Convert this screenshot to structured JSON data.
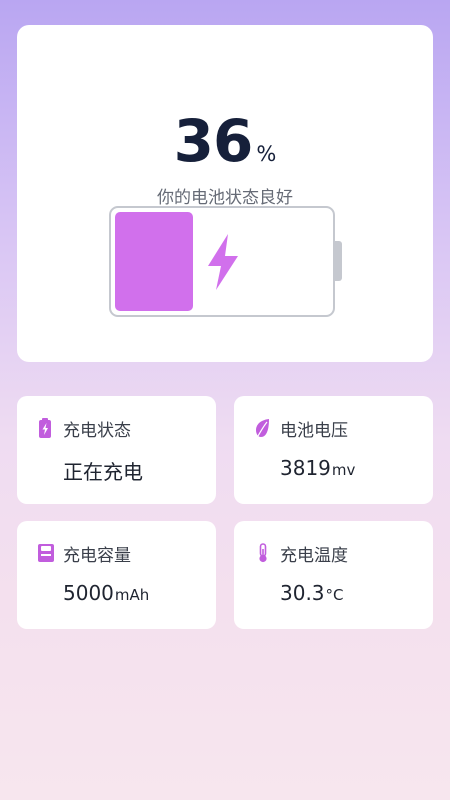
{
  "battery": {
    "percent_value": "36",
    "percent_sign": "%",
    "status_text": "你的电池状态良好",
    "level": 0.36,
    "fill_color": "#d170ec"
  },
  "tiles": [
    {
      "label": "充电状态",
      "value": "正在充电",
      "unit": "",
      "icon": "battery-charging-icon"
    },
    {
      "label": "电池电压",
      "value": "3819",
      "unit": "mv",
      "icon": "leaf-icon"
    },
    {
      "label": "充电容量",
      "value": "5000",
      "unit": "mAh",
      "icon": "sd-card-icon"
    },
    {
      "label": "充电温度",
      "value": "30.3",
      "unit": "°C",
      "icon": "thermometer-icon"
    }
  ],
  "colors": {
    "accent": "#d170ec",
    "text_dark": "#16203a",
    "text_muted": "#666b76"
  }
}
